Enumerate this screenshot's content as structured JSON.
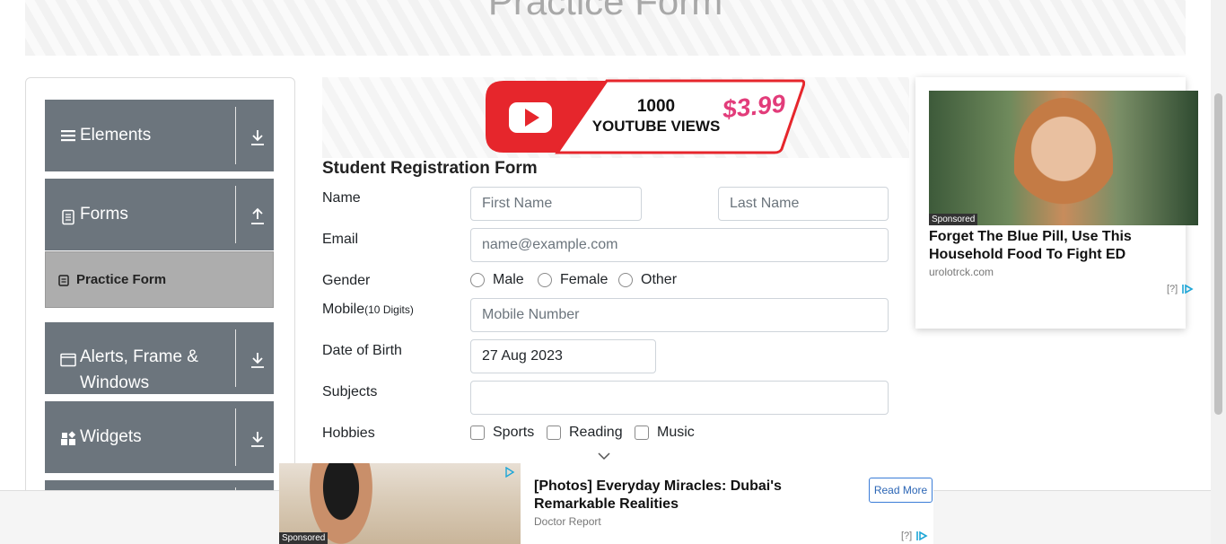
{
  "banner": {
    "title": "Practice Form"
  },
  "sidebar": {
    "groups": [
      {
        "label": "Elements",
        "icon": "menu-icon",
        "state": "collapsed"
      },
      {
        "label": "Forms",
        "icon": "document-icon",
        "state": "expanded"
      },
      {
        "label": "Alerts, Frame &",
        "label2": "Windows",
        "icon": "window-icon",
        "state": "collapsed"
      },
      {
        "label": "Widgets",
        "icon": "widgets-icon",
        "state": "collapsed"
      }
    ],
    "active_item": "Practice Form"
  },
  "top_ad": {
    "line1": "1000",
    "line2": "YOUTUBE VIEWS",
    "price": "$3.99"
  },
  "form": {
    "title": "Student Registration Form",
    "name_label": "Name",
    "first_name_placeholder": "First Name",
    "last_name_placeholder": "Last Name",
    "email_label": "Email",
    "email_placeholder": "name@example.com",
    "gender_label": "Gender",
    "gender_options": [
      "Male",
      "Female",
      "Other"
    ],
    "mobile_label": "Mobile",
    "mobile_hint": "(10 Digits)",
    "mobile_placeholder": "Mobile Number",
    "dob_label": "Date of Birth",
    "dob_value": "27 Aug 2023",
    "subjects_label": "Subjects",
    "hobbies_label": "Hobbies",
    "hobby_options": [
      "Sports",
      "Reading",
      "Music"
    ]
  },
  "side_ad": {
    "badge": "Sponsored",
    "headline": "Forget The Blue Pill, Use This Household Food To Fight ED",
    "domain": "urolotrck.com",
    "adchoice": "[?]"
  },
  "bottom_ad": {
    "badge": "Sponsored",
    "headline": "[Photos] Everyday Miracles: Dubai's Remarkable Realities",
    "domain": "Doctor Report",
    "cta": "Read More",
    "adchoice": "[?]"
  }
}
